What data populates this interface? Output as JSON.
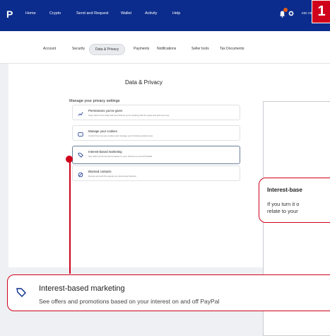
{
  "topnav": {
    "items": [
      "Home",
      "Crypto",
      "Send and Request",
      "Wallet",
      "Activity",
      "Help"
    ],
    "user_label": "coc co"
  },
  "badge": "1",
  "subnav": {
    "tabs": [
      "Account",
      "Security",
      "Data & Privacy",
      "Payments",
      "Notifications",
      "Seller tools",
      "Tax Documents"
    ]
  },
  "page": {
    "title": "Data & Privacy",
    "settings_heading": "Manage your privacy settings",
    "rows": [
      {
        "title": "Permissions you've given",
        "desc": "Keep track of the data and permissions you're sharing with the apps and sites you use."
      },
      {
        "title": "Manage your cookies",
        "desc": "Control how we use cookies and manage your browsing preferences."
      },
      {
        "title": "Interest-based marketing",
        "desc": "See offers and promotions based on your interest on and off PayPal."
      },
      {
        "title": "Blocked contacts",
        "desc": "Review and edit the people you previously blocked."
      }
    ]
  },
  "callout_panel": {
    "title": "Interest-base",
    "line1": "If you turn it o",
    "line2": "relate to your"
  },
  "callout_zoom": {
    "title": "Interest-based marketing",
    "desc": "See offers and promotions based on your interest on and off PayPal"
  },
  "colors": {
    "accent": "#d0021b",
    "nav_bg": "#0b2c8c"
  }
}
